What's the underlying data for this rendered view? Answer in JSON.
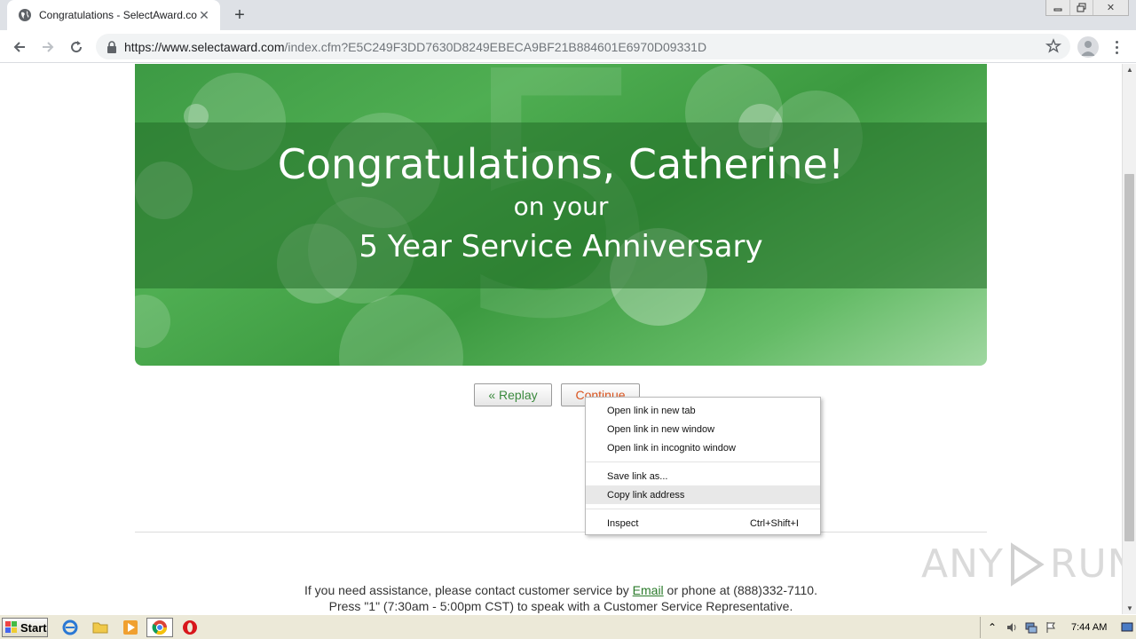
{
  "browser": {
    "tab_title": "Congratulations - SelectAward.com",
    "new_tab_symbol": "+",
    "url_host": "https://www.selectaward.com",
    "url_rest": "/index.cfm?E5C249F3DD7630D8249EBECA9BF21B884601E6970D09331D"
  },
  "banner": {
    "heading": "Congratulations, Catherine!",
    "subheading": "on your",
    "anniversary": "5 Year Service Anniversary",
    "background_digit": "5"
  },
  "buttons": {
    "replay": "« Replay",
    "continue": "Continue"
  },
  "context_menu": {
    "items": [
      {
        "label": "Open link in new tab",
        "shortcut": ""
      },
      {
        "label": "Open link in new window",
        "shortcut": ""
      },
      {
        "label": "Open link in incognito window",
        "shortcut": ""
      },
      {
        "label": "Save link as...",
        "shortcut": ""
      },
      {
        "label": "Copy link address",
        "shortcut": ""
      },
      {
        "label": "Inspect",
        "shortcut": "Ctrl+Shift+I"
      }
    ]
  },
  "footer": {
    "line1_before": "If you need assistance, please contact customer service by ",
    "line1_link": "Email",
    "line1_after": " or phone at (888)332-7110.",
    "line2": "Press \"1\" (7:30am - 5:00pm CST) to speak with a Customer Service Representative."
  },
  "watermark": {
    "left": "ANY",
    "right": "RUN"
  },
  "taskbar": {
    "start_label": "Start",
    "clock": "7:44 AM"
  },
  "colors": {
    "banner_green": "#4fae52",
    "replay_text": "#3b8a3e",
    "continue_text": "#d9531e",
    "link_green": "#2a7a2a"
  }
}
